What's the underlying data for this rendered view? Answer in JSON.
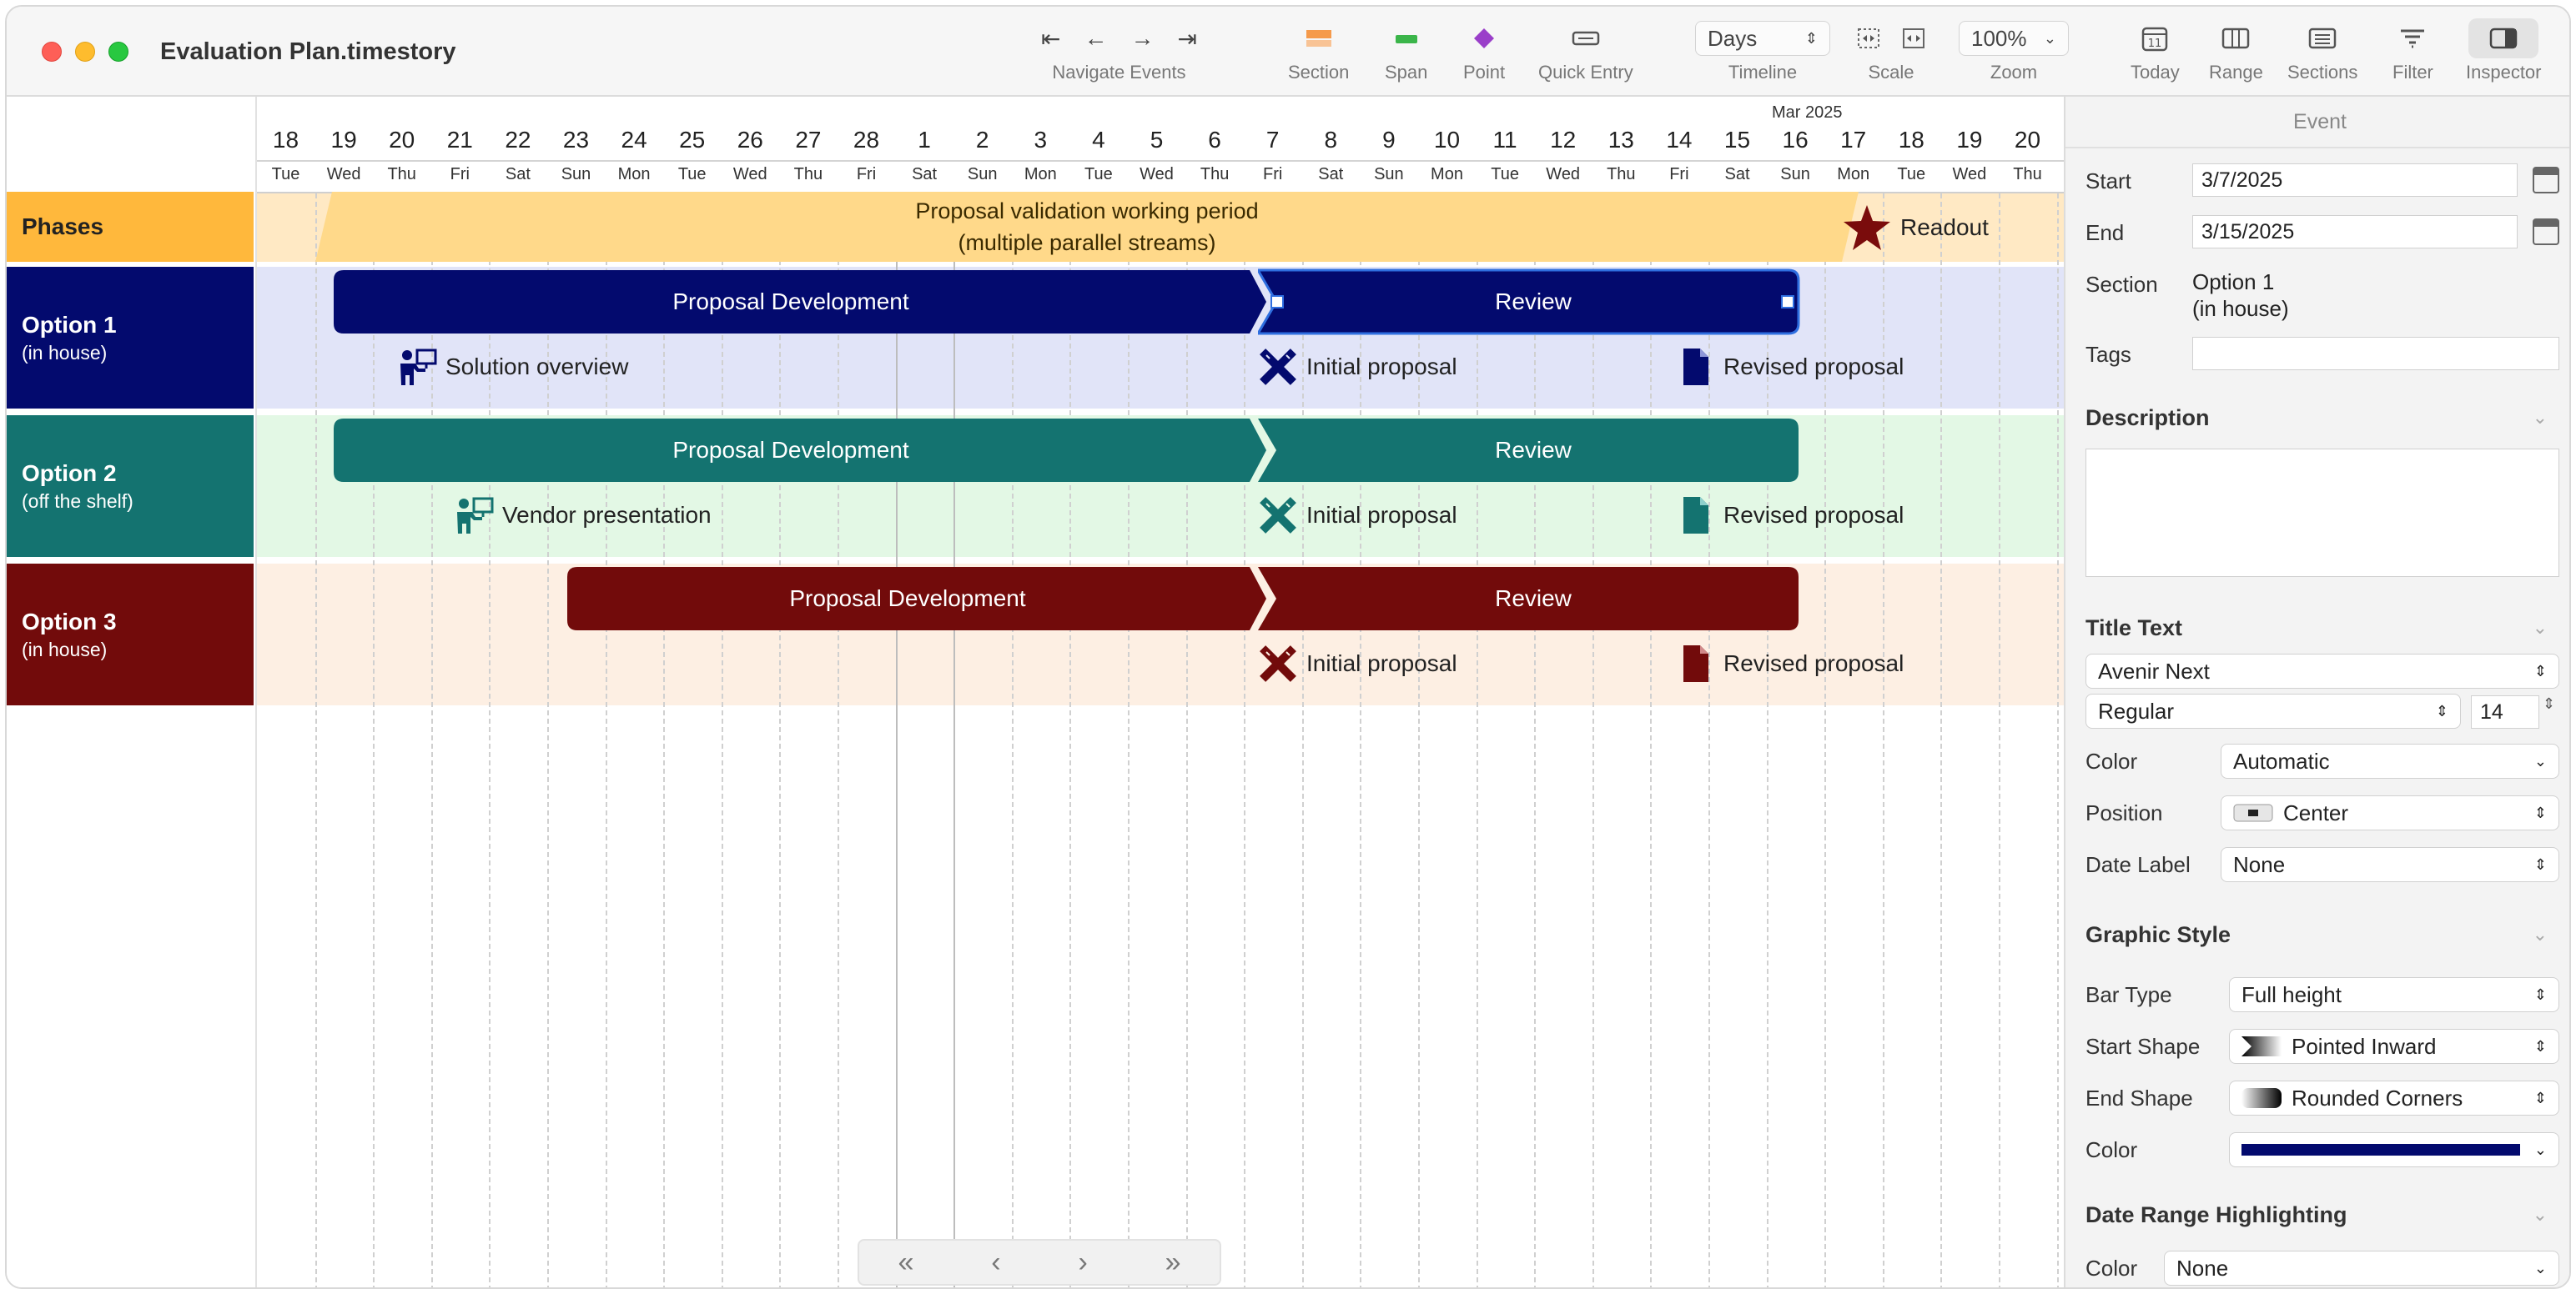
{
  "window": {
    "title": "Evaluation Plan.timestory"
  },
  "toolbar": {
    "navigate_label": "Navigate Events",
    "section_label": "Section",
    "span_label": "Span",
    "point_label": "Point",
    "quick_entry_label": "Quick Entry",
    "timeline_label": "Timeline",
    "timeline_value": "Days",
    "scale_label": "Scale",
    "zoom_label": "Zoom",
    "zoom_value": "100%",
    "today_label": "Today",
    "range_label": "Range",
    "sections_label": "Sections",
    "filter_label": "Filter",
    "inspector_label": "Inspector",
    "icons": {
      "first": "⇤",
      "prev": "←",
      "next": "→",
      "last": "⇥"
    }
  },
  "colors": {
    "phases": "#ffb83c",
    "phase_band": "#ffe9c4",
    "phase_span": "#ffd98a",
    "option1": "#030a6e",
    "option1_band": "#e1e4f8",
    "option2": "#147370",
    "option2_band": "#e3f8e5",
    "option3": "#720b0b",
    "option3_band": "#fdefe3",
    "readout_star": "#7a0c0c"
  },
  "timeline": {
    "month_label": "Mar 2025",
    "days": [
      {
        "num": "18",
        "name": "Tue"
      },
      {
        "num": "19",
        "name": "Wed"
      },
      {
        "num": "20",
        "name": "Thu"
      },
      {
        "num": "21",
        "name": "Fri"
      },
      {
        "num": "22",
        "name": "Sat"
      },
      {
        "num": "23",
        "name": "Sun"
      },
      {
        "num": "24",
        "name": "Mon"
      },
      {
        "num": "25",
        "name": "Tue"
      },
      {
        "num": "26",
        "name": "Wed"
      },
      {
        "num": "27",
        "name": "Thu"
      },
      {
        "num": "28",
        "name": "Fri"
      },
      {
        "num": "1",
        "name": "Sat"
      },
      {
        "num": "2",
        "name": "Sun"
      },
      {
        "num": "3",
        "name": "Mon"
      },
      {
        "num": "4",
        "name": "Tue"
      },
      {
        "num": "5",
        "name": "Wed"
      },
      {
        "num": "6",
        "name": "Thu"
      },
      {
        "num": "7",
        "name": "Fri"
      },
      {
        "num": "8",
        "name": "Sat"
      },
      {
        "num": "9",
        "name": "Sun"
      },
      {
        "num": "10",
        "name": "Mon"
      },
      {
        "num": "11",
        "name": "Tue"
      },
      {
        "num": "12",
        "name": "Wed"
      },
      {
        "num": "13",
        "name": "Thu"
      },
      {
        "num": "14",
        "name": "Fri"
      },
      {
        "num": "15",
        "name": "Sat"
      },
      {
        "num": "16",
        "name": "Sun"
      },
      {
        "num": "17",
        "name": "Mon"
      },
      {
        "num": "18",
        "name": "Tue"
      },
      {
        "num": "19",
        "name": "Wed"
      },
      {
        "num": "20",
        "name": "Thu"
      }
    ]
  },
  "sections": [
    {
      "title": "Phases",
      "subtitle": ""
    },
    {
      "title": "Option 1",
      "subtitle": "(in house)"
    },
    {
      "title": "Option 2",
      "subtitle": "(off the shelf)"
    },
    {
      "title": "Option 3",
      "subtitle": "(in house)"
    }
  ],
  "phases": {
    "span_line1": "Proposal validation working period",
    "span_line2": "(multiple parallel streams)",
    "readout": "Readout"
  },
  "option1": {
    "dev": "Proposal Development",
    "review": "Review",
    "events": [
      "Solution overview",
      "Initial proposal",
      "Revised proposal"
    ]
  },
  "option2": {
    "dev": "Proposal Development",
    "review": "Review",
    "events": [
      "Vendor presentation",
      "Initial proposal",
      "Revised proposal"
    ]
  },
  "option3": {
    "dev": "Proposal Development",
    "review": "Review",
    "events": [
      "Initial proposal",
      "Revised proposal"
    ]
  },
  "pager": {
    "first": "«",
    "prev": "‹",
    "next": "›",
    "last": "»"
  },
  "inspector": {
    "tab": "Event",
    "start_label": "Start",
    "start_value": "3/7/2025",
    "end_label": "End",
    "end_value": "3/15/2025",
    "section_label": "Section",
    "section_value1": "Option 1",
    "section_value2": "(in house)",
    "tags_label": "Tags",
    "tags_value": "",
    "description_heading": "Description",
    "description_value": "",
    "title_text_heading": "Title Text",
    "font_family": "Avenir Next",
    "font_weight": "Regular",
    "font_size": "14",
    "color_label": "Color",
    "color_value": "Automatic",
    "position_label": "Position",
    "position_value": "Center",
    "date_label_label": "Date Label",
    "date_label_value": "None",
    "graphic_style_heading": "Graphic Style",
    "bar_type_label": "Bar Type",
    "bar_type_value": "Full height",
    "start_shape_label": "Start Shape",
    "start_shape_value": "Pointed Inward",
    "end_shape_label": "End Shape",
    "end_shape_value": "Rounded Corners",
    "gs_color_label": "Color",
    "gs_color_swatch": "#030a6e",
    "date_range_heading": "Date Range Highlighting",
    "dr_color_label": "Color",
    "dr_color_value": "None"
  }
}
